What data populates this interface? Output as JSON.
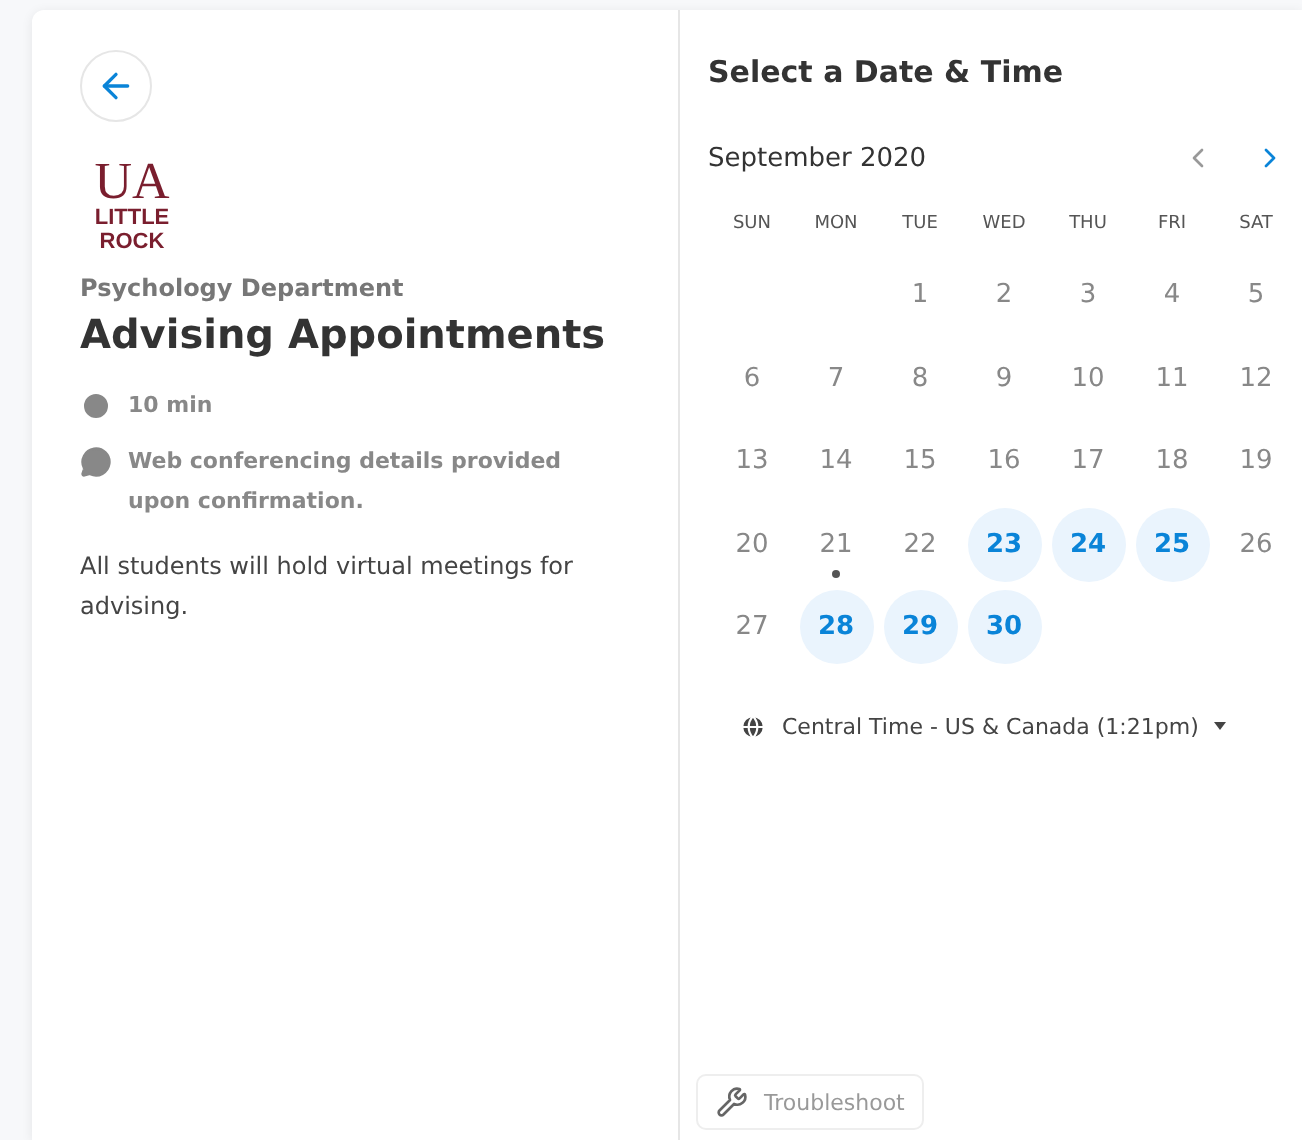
{
  "event": {
    "logo": [
      "UA",
      "LITTLE",
      "ROCK"
    ],
    "department": "Psychology Department",
    "title": "Advising Appointments",
    "details": [
      {
        "kind": "duration",
        "text": "10 min"
      },
      {
        "kind": "conferencing",
        "text": "Web conferencing details provided upon confirmation."
      }
    ],
    "description": "All students will hold virtual meetings for advising."
  },
  "calendar": {
    "heading": "Select a Date & Time",
    "month": "September 2020",
    "prev": {
      "disabled": true
    },
    "next": {
      "disabled": false
    },
    "weekdays": [
      "SUN",
      "MON",
      "TUE",
      "WED",
      "THU",
      "FRI",
      "SAT"
    ],
    "weeks": [
      [
        {
          "kind": "blank"
        },
        {
          "kind": "blank"
        },
        {
          "kind": "day",
          "label": "1",
          "available": false,
          "today": false
        },
        {
          "kind": "day",
          "label": "2",
          "available": false,
          "today": false
        },
        {
          "kind": "day",
          "label": "3",
          "available": false,
          "today": false
        },
        {
          "kind": "day",
          "label": "4",
          "available": false,
          "today": false
        },
        {
          "kind": "day",
          "label": "5",
          "available": false,
          "today": false
        }
      ],
      [
        {
          "kind": "day",
          "label": "6",
          "available": false,
          "today": false
        },
        {
          "kind": "day",
          "label": "7",
          "available": false,
          "today": false
        },
        {
          "kind": "day",
          "label": "8",
          "available": false,
          "today": false
        },
        {
          "kind": "day",
          "label": "9",
          "available": false,
          "today": false
        },
        {
          "kind": "day",
          "label": "10",
          "available": false,
          "today": false
        },
        {
          "kind": "day",
          "label": "11",
          "available": false,
          "today": false
        },
        {
          "kind": "day",
          "label": "12",
          "available": false,
          "today": false
        }
      ],
      [
        {
          "kind": "day",
          "label": "13",
          "available": false,
          "today": false
        },
        {
          "kind": "day",
          "label": "14",
          "available": false,
          "today": false
        },
        {
          "kind": "day",
          "label": "15",
          "available": false,
          "today": false
        },
        {
          "kind": "day",
          "label": "16",
          "available": false,
          "today": false
        },
        {
          "kind": "day",
          "label": "17",
          "available": false,
          "today": false
        },
        {
          "kind": "day",
          "label": "18",
          "available": false,
          "today": false
        },
        {
          "kind": "day",
          "label": "19",
          "available": false,
          "today": false
        }
      ],
      [
        {
          "kind": "day",
          "label": "20",
          "available": false,
          "today": false
        },
        {
          "kind": "day",
          "label": "21",
          "available": false,
          "today": true
        },
        {
          "kind": "day",
          "label": "22",
          "available": false,
          "today": false
        },
        {
          "kind": "day",
          "label": "23",
          "available": true,
          "today": false
        },
        {
          "kind": "day",
          "label": "24",
          "available": true,
          "today": false
        },
        {
          "kind": "day",
          "label": "25",
          "available": true,
          "today": false
        },
        {
          "kind": "day",
          "label": "26",
          "available": false,
          "today": false
        }
      ],
      [
        {
          "kind": "day",
          "label": "27",
          "available": false,
          "today": false
        },
        {
          "kind": "day",
          "label": "28",
          "available": true,
          "today": false
        },
        {
          "kind": "day",
          "label": "29",
          "available": true,
          "today": false
        },
        {
          "kind": "day",
          "label": "30",
          "available": true,
          "today": false
        }
      ]
    ],
    "timezone": "Central Time - US & Canada (1:21pm)"
  },
  "troubleshoot": "Troubleshoot"
}
